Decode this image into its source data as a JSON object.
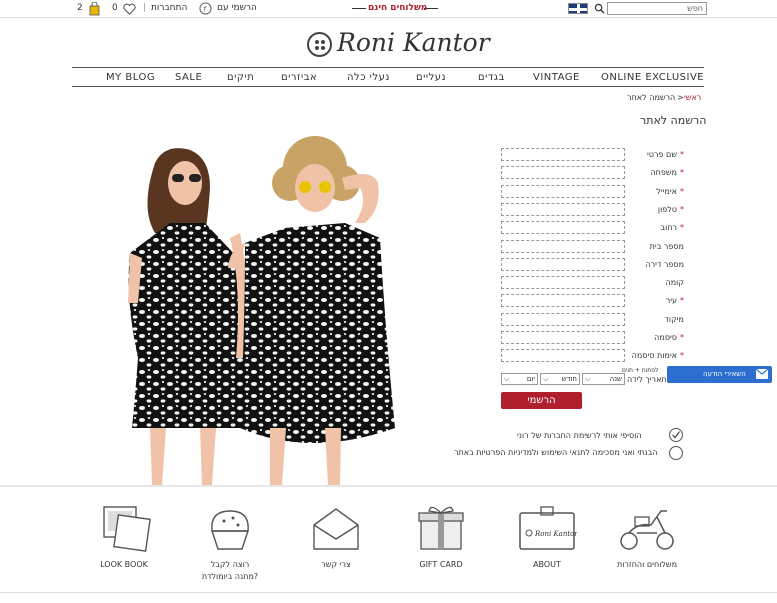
{
  "topbar": {
    "search_placeholder": "חפש",
    "shipping_text": "משלוחים חינם",
    "join_text": "הרשמי עם",
    "login_text": "התחברות",
    "wishlist_count": "0",
    "cart_count": "2"
  },
  "logo": {
    "text": "Roni Kantor"
  },
  "nav": {
    "items": [
      "ONLINE EXCLUSIVE",
      "VINTAGE",
      "בגדים",
      "נעליים",
      "נעלי כלה",
      "אביזרים",
      "תיקים",
      "SALE",
      "MY BLOG"
    ]
  },
  "breadcrumb": {
    "home": "ראשי",
    "separator": ">",
    "current": "הרשמה לאתר"
  },
  "page_title": "הרשמה לאתר",
  "form": {
    "fields": [
      {
        "label": "שם פרטי",
        "required": true
      },
      {
        "label": "משפחה",
        "required": true
      },
      {
        "label": "אימייל",
        "required": true
      },
      {
        "label": "טלפון",
        "required": true
      },
      {
        "label": "רחוב",
        "required": true
      },
      {
        "label": "מספר בית",
        "required": false
      },
      {
        "label": "מספר דירה",
        "required": false
      },
      {
        "label": "קומה",
        "required": false
      },
      {
        "label": "עיר",
        "required": true
      },
      {
        "label": "מיקוד",
        "required": false
      },
      {
        "label": "סיסמה",
        "required": true
      },
      {
        "label": "אימות סיסמה",
        "required": true
      }
    ],
    "birthday_label": "תאריך לידה",
    "birthday_hint": "לפתוח + תוים",
    "year": "שנה",
    "month": "חודש",
    "day": "יום",
    "submit_label": "הרשמי",
    "newsletter_label": "הוסיפי אותי לרשימת החברות של רוני",
    "terms_label": "הבנתי ואני מסכימה לתנאי השימוש ולמדיניות הפרטיות באתר",
    "required_mark": "*"
  },
  "chat_widget": {
    "label": "השאירי הודעה"
  },
  "footer": {
    "items": [
      {
        "label": "משלוחים והחזרות",
        "icon": "scooter-icon"
      },
      {
        "label": "ABOUT",
        "icon": "card-icon"
      },
      {
        "label": "GIFT CARD",
        "icon": "gift-icon"
      },
      {
        "label": "צרי קשר",
        "icon": "envelope-icon"
      },
      {
        "label": "רוצה לקבל",
        "label2": "מתנה ביומולדת?",
        "icon": "cupcake-icon"
      },
      {
        "label": "LOOK BOOK",
        "icon": "photos-icon"
      }
    ]
  },
  "colors": {
    "accent": "#b0202c",
    "chat": "#2c6fd1"
  }
}
